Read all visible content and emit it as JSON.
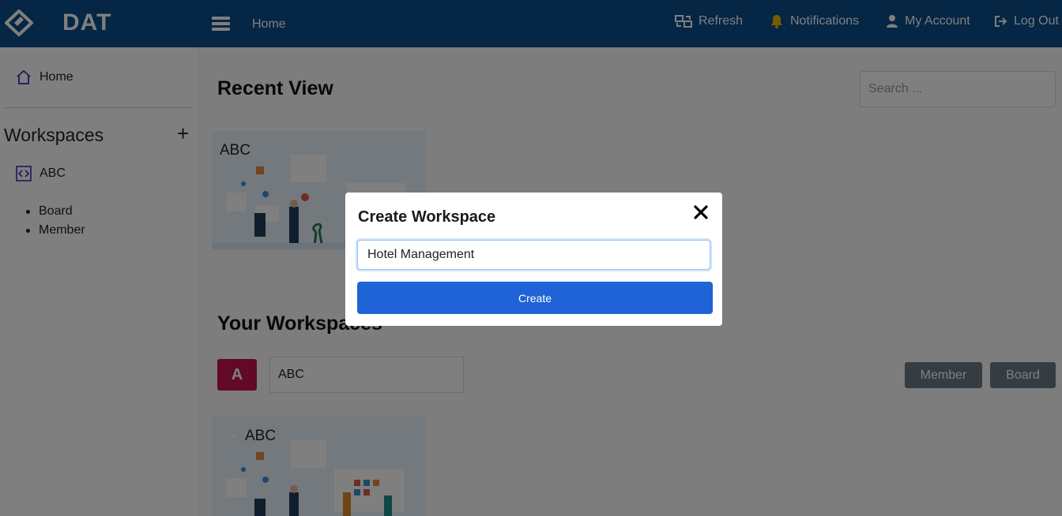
{
  "app": {
    "brand": "DAT"
  },
  "topnav": {
    "home": "Home",
    "refresh": "Refresh",
    "notifications": "Notifications",
    "account": "My Account",
    "logout": "Log Out"
  },
  "sidebar": {
    "home": "Home",
    "workspaces_title": "Workspaces",
    "add_symbol": "+",
    "workspace_item": "ABC",
    "sub_items": [
      "Board",
      "Member"
    ]
  },
  "main": {
    "recent_title": "Recent View",
    "search_placeholder": "Search ...",
    "recent_card_title": "ABC",
    "your_workspaces_title": "Your Workspaces",
    "workspace_avatar": "A",
    "workspace_name": "ABC",
    "member_button": "Member",
    "board_button": "Board",
    "board_card_title": "ABC"
  },
  "modal": {
    "title": "Create Workspace",
    "input_value": "Hotel Management",
    "create_button": "Create"
  },
  "colors": {
    "topbar": "#0a4c8a",
    "primary_button": "#1f63d6",
    "avatar": "#c3124b",
    "secondary_button": "#6b7a86"
  }
}
